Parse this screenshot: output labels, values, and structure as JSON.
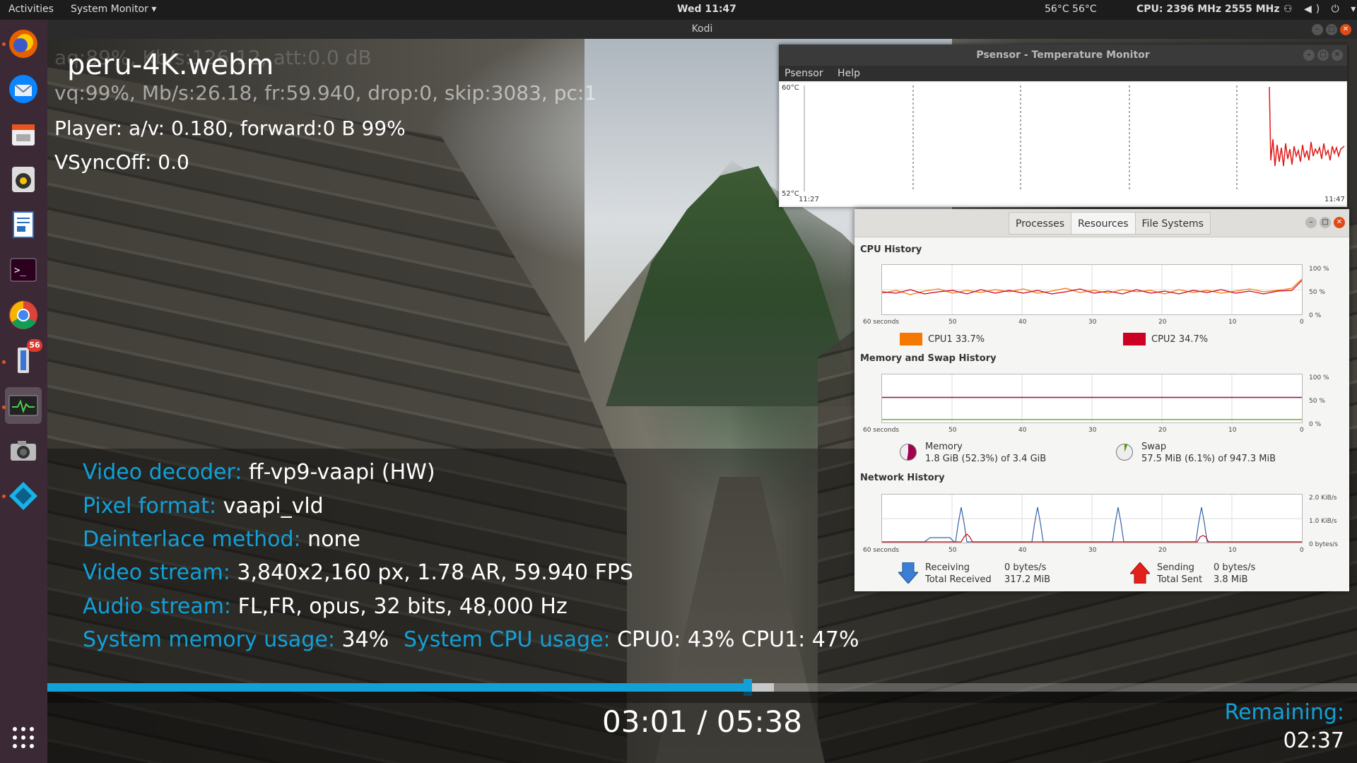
{
  "topbar": {
    "activities": "Activities",
    "app_menu": "System Monitor ▾",
    "clock": "Wed 11:47",
    "temperature": "56°C 56°C",
    "cpu_freq": "CPU: 2396 MHz 2555 MHz",
    "tray_icons": "⚇ ◀) ⏻ ▾"
  },
  "dock": {
    "items": [
      "firefox-icon",
      "thunderbird-icon",
      "files-icon",
      "rhythmbox-icon",
      "libreoffice-writer-icon",
      "terminal-icon",
      "chrome-icon",
      "updates-icon",
      "system-monitor-icon",
      "camera-icon",
      "kodi-icon",
      "app-grid-icon"
    ],
    "badge": "56"
  },
  "kodi": {
    "window_title": "Kodi",
    "ghost_line": "aq:89%, Kb/s:126.12, att:0.0 dB",
    "filename": "peru-4K.webm",
    "vq_line": "vq:99%, Mb/s:26.18, fr:59.940, drop:0, skip:3083, pc:1",
    "player_line": "Player: a/v: 0.180,  forward:0 B 99%",
    "vsync_line": "VSyncOff: 0.0",
    "info": [
      {
        "label": "Video decoder:",
        "value": " ff-vp9-vaapi (HW)"
      },
      {
        "label": "Pixel format:",
        "value": " vaapi_vld"
      },
      {
        "label": "Deinterlace method:",
        "value": " none"
      },
      {
        "label": "Video stream:",
        "value": " 3,840x2,160 px, 1.78 AR, 59.940 FPS"
      },
      {
        "label": "Audio stream:",
        "value": " FL,FR, opus, 32 bits, 48,000 Hz"
      }
    ],
    "mem_label": "System memory usage:",
    "mem_value": " 34%",
    "cpu_label": "System CPU usage:",
    "cpu_value": " CPU0:  43% CPU1:  47%",
    "progress_fraction": 0.535,
    "buffer_fraction": 0.457,
    "time": "03:01 / 05:38",
    "remaining_label": "Remaining:",
    "remaining_value": "02:37"
  },
  "psensor": {
    "title": "Psensor - Temperature Monitor",
    "menu": [
      "Psensor",
      "Help"
    ],
    "y_top": "60°C",
    "y_bottom": "52°C",
    "x_left": "11:27",
    "x_right": "11:47"
  },
  "sysmon": {
    "tabs": [
      "Processes",
      "Resources",
      "File Systems"
    ],
    "active_tab": 1,
    "cpu": {
      "title": "CPU History",
      "x_ticks": [
        "60 seconds",
        "50",
        "40",
        "30",
        "20",
        "10",
        "0"
      ],
      "y_ticks": [
        "100 %",
        "50 %",
        "0 %"
      ],
      "cpu1_label": "CPU1  33.7%",
      "cpu2_label": "CPU2  34.7%",
      "cpu1_color": "#f57900",
      "cpu2_color": "#cc0022"
    },
    "mem": {
      "title": "Memory and Swap History",
      "x_ticks": [
        "60 seconds",
        "50",
        "40",
        "30",
        "20",
        "10",
        "0"
      ],
      "y_ticks": [
        "100 %",
        "50 %",
        "0 %"
      ],
      "memory_label": "Memory",
      "memory_value": "1.8 GiB (52.3%) of 3.4 GiB",
      "swap_label": "Swap",
      "swap_value": "57.5 MiB (6.1%) of 947.3 MiB",
      "memory_fraction": 0.523,
      "swap_fraction": 0.061
    },
    "net": {
      "title": "Network History",
      "x_ticks": [
        "60 seconds",
        "50",
        "40",
        "30",
        "20",
        "10",
        "0"
      ],
      "y_ticks": [
        "2.0 KiB/s",
        "1.0 KiB/s",
        "0 bytes/s"
      ],
      "receiving_label": "Receiving",
      "total_received_label": "Total Received",
      "receiving_rate": "0 bytes/s",
      "total_received": "317.2 MiB",
      "sending_label": "Sending",
      "total_sent_label": "Total Sent",
      "sending_rate": "0 bytes/s",
      "total_sent": "3.8 MiB"
    }
  }
}
